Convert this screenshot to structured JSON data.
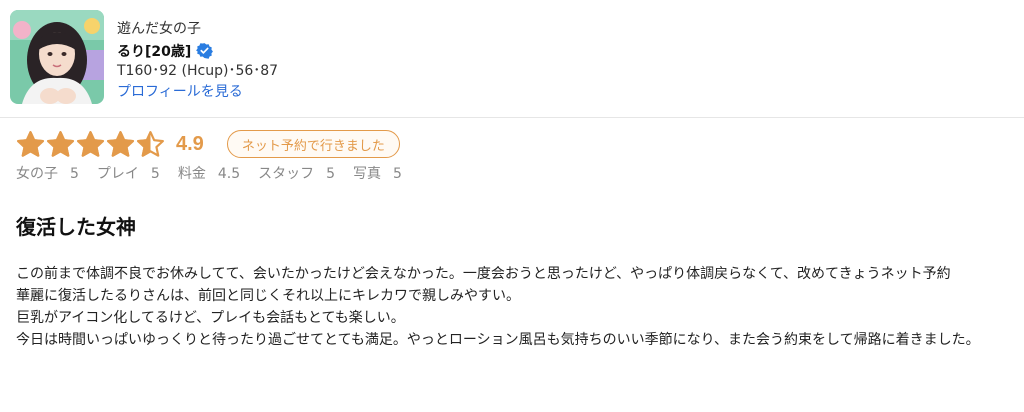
{
  "profile": {
    "caption": "遊んだ女の子",
    "name": "るり[20歳]",
    "stats": "T160･92 (Hcup)･56･87",
    "profile_link": "プロフィールを見る",
    "verified_color": "#2a7de1"
  },
  "review": {
    "rating": 4.9,
    "rating_text": "4.9",
    "star_color": "#e39a4a",
    "badge": "ネット予約で行きました",
    "subscores": [
      {
        "label": "女の子",
        "value": "5"
      },
      {
        "label": "プレイ",
        "value": "5"
      },
      {
        "label": "料金",
        "value": "4.5"
      },
      {
        "label": "スタッフ",
        "value": "5"
      },
      {
        "label": "写真",
        "value": "5"
      }
    ],
    "title": "復活した女神",
    "body": [
      "この前まで体調不良でお休みしてて、会いたかったけど会えなかった。一度会おうと思ったけど、やっぱり体調戻らなくて、改めてきょうネット予約",
      "華麗に復活したるりさんは、前回と同じくそれ以上にキレカワで親しみやすい。",
      "巨乳がアイコン化してるけど、プレイも会話もとても楽しい。",
      "今日は時間いっぱいゆっくりと待ったり過ごせてとても満足。やっとローション風呂も気持ちのいい季節になり、また会う約束をして帰路に着きました。"
    ]
  }
}
